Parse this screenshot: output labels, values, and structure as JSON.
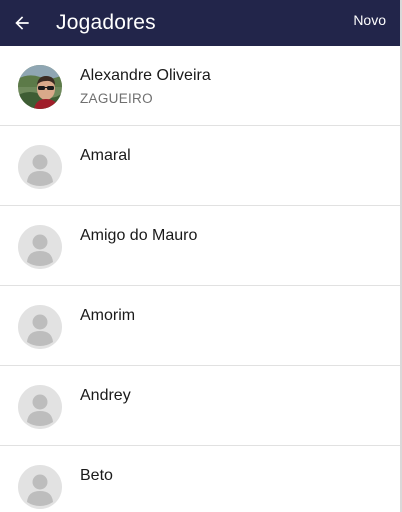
{
  "header": {
    "title": "Jogadores",
    "new_label": "Novo",
    "background_color": "#22254a"
  },
  "players": [
    {
      "name": "Alexandre Oliveira",
      "position": "ZAGUEIRO",
      "avatar": "photo"
    },
    {
      "name": "Amaral",
      "position": "",
      "avatar": "placeholder-person-icon"
    },
    {
      "name": "Amigo do Mauro",
      "position": "",
      "avatar": "placeholder-person-icon"
    },
    {
      "name": "Amorim",
      "position": "",
      "avatar": "placeholder-person-icon"
    },
    {
      "name": "Andrey",
      "position": "",
      "avatar": "placeholder-person-icon"
    },
    {
      "name": "Beto",
      "position": "",
      "avatar": "placeholder-person-icon"
    }
  ]
}
